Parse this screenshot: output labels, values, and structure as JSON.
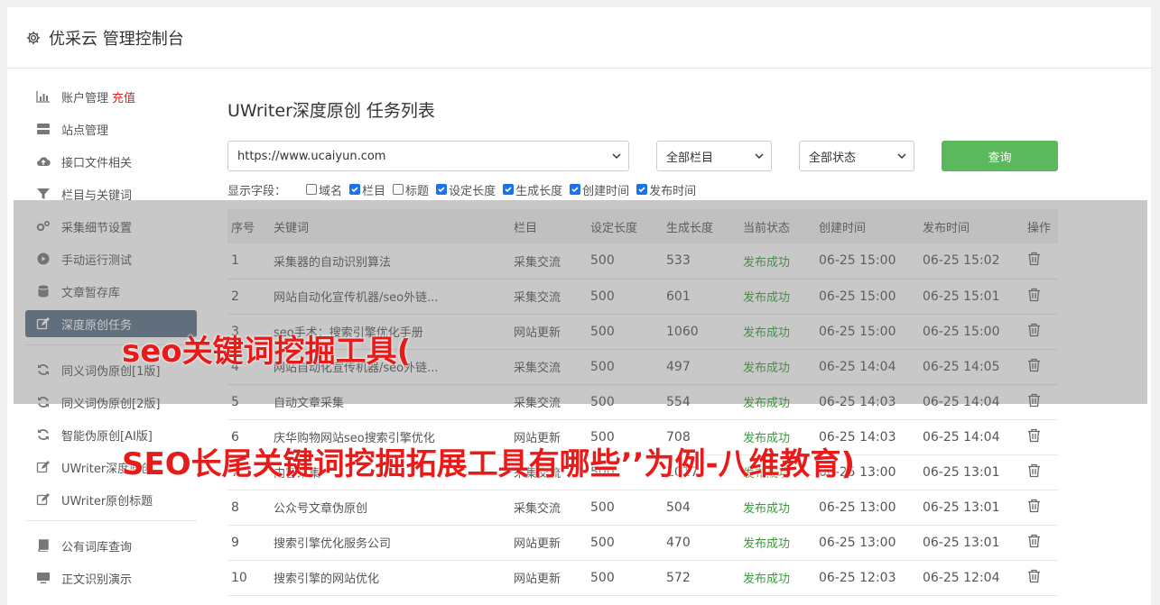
{
  "header": {
    "title": "优采云 管理控制台"
  },
  "sidebar": {
    "group1": [
      {
        "label": "账户管理",
        "badge": "充值",
        "icon": "bar-chart-icon"
      },
      {
        "label": "站点管理",
        "icon": "server-icon"
      },
      {
        "label": "接口文件相关",
        "icon": "cloud-upload-icon"
      },
      {
        "label": "栏目与关键词",
        "icon": "filter-icon"
      },
      {
        "label": "采集细节设置",
        "icon": "gears-icon"
      },
      {
        "label": "手动运行测试",
        "icon": "play-circle-icon"
      },
      {
        "label": "文章暂存库",
        "icon": "database-icon"
      },
      {
        "label": "深度原创任务",
        "icon": "edit-icon",
        "active": true
      }
    ],
    "group2": [
      {
        "label": "同义词伪原创[1版]",
        "icon": "refresh-icon"
      },
      {
        "label": "同义词伪原创[2版]",
        "icon": "refresh-icon"
      },
      {
        "label": "智能伪原创[AI版]",
        "icon": "refresh-icon"
      },
      {
        "label": "UWriter深度原创",
        "icon": "edit-icon"
      },
      {
        "label": "UWriter原创标题",
        "icon": "edit-icon"
      }
    ],
    "group3": [
      {
        "label": "公有词库查询",
        "icon": "book-icon"
      },
      {
        "label": "正文识别演示",
        "icon": "monitor-icon"
      }
    ]
  },
  "page": {
    "title": "UWriter深度原创 任务列表",
    "site_select": "https://www.ucaiyun.com",
    "column_select": "全部栏目",
    "status_select": "全部状态",
    "query_button": "查询",
    "fields_label": "显示字段：",
    "fields": [
      {
        "label": "域名",
        "checked": false
      },
      {
        "label": "栏目",
        "checked": true
      },
      {
        "label": "标题",
        "checked": false
      },
      {
        "label": "设定长度",
        "checked": true
      },
      {
        "label": "生成长度",
        "checked": true
      },
      {
        "label": "创建时间",
        "checked": true
      },
      {
        "label": "发布时间",
        "checked": true
      }
    ]
  },
  "table": {
    "headers": [
      "序号",
      "关键词",
      "栏目",
      "设定长度",
      "生成长度",
      "当前状态",
      "创建时间",
      "发布时间",
      "操作"
    ],
    "rows": [
      {
        "no": "1",
        "keyword": "采集器的自动识别算法",
        "column": "采集交流",
        "set_len": "500",
        "gen_len": "533",
        "status": "发布成功",
        "created": "06-25 15:00",
        "published": "06-25 15:02"
      },
      {
        "no": "2",
        "keyword": "网站自动化宣传机器/seo外链...",
        "column": "采集交流",
        "set_len": "500",
        "gen_len": "601",
        "status": "发布成功",
        "created": "06-25 15:00",
        "published": "06-25 15:01"
      },
      {
        "no": "3",
        "keyword": "seo手术：搜索引擎优化手册",
        "column": "网站更新",
        "set_len": "500",
        "gen_len": "1060",
        "status": "发布成功",
        "created": "06-25 15:00",
        "published": "06-25 15:00"
      },
      {
        "no": "4",
        "keyword": "网站自动化宣传机器/seo外链...",
        "column": "采集交流",
        "set_len": "500",
        "gen_len": "497",
        "status": "发布成功",
        "created": "06-25 14:04",
        "published": "06-25 14:05"
      },
      {
        "no": "5",
        "keyword": "自动文章采集",
        "column": "采集交流",
        "set_len": "500",
        "gen_len": "554",
        "status": "发布成功",
        "created": "06-25 14:03",
        "published": "06-25 14:04"
      },
      {
        "no": "6",
        "keyword": "庆华购物网站seo搜索引擎优化",
        "column": "网站更新",
        "set_len": "500",
        "gen_len": "708",
        "status": "发布成功",
        "created": "06-25 14:03",
        "published": "06-25 14:04"
      },
      {
        "no": "7",
        "keyword": "内容采集",
        "column": "采集交流",
        "set_len": "500",
        "gen_len": "1017",
        "status": "发布成功",
        "created": "06-25 13:00",
        "published": "06-25 13:01"
      },
      {
        "no": "8",
        "keyword": "公众号文章伪原创",
        "column": "采集交流",
        "set_len": "500",
        "gen_len": "504",
        "status": "发布成功",
        "created": "06-25 13:00",
        "published": "06-25 13:01"
      },
      {
        "no": "9",
        "keyword": "搜索引擎优化服务公司",
        "column": "网站更新",
        "set_len": "500",
        "gen_len": "470",
        "status": "发布成功",
        "created": "06-25 13:00",
        "published": "06-25 13:01"
      },
      {
        "no": "10",
        "keyword": "搜索引擎的网站优化",
        "column": "网站更新",
        "set_len": "500",
        "gen_len": "572",
        "status": "发布成功",
        "created": "06-25 12:03",
        "published": "06-25 12:04"
      }
    ]
  },
  "overlay": {
    "line1": "seo关键词挖掘工具(",
    "line2": "SEO长尾关键词挖掘拓展工具有哪些’’为例-八维教育)"
  },
  "colors": {
    "accent_green": "#5cb85c",
    "active_side": "#5a6f83",
    "recharge_red": "#e02020",
    "status_green": "#3a9b3a",
    "overlay_text": "#e81b1b"
  }
}
